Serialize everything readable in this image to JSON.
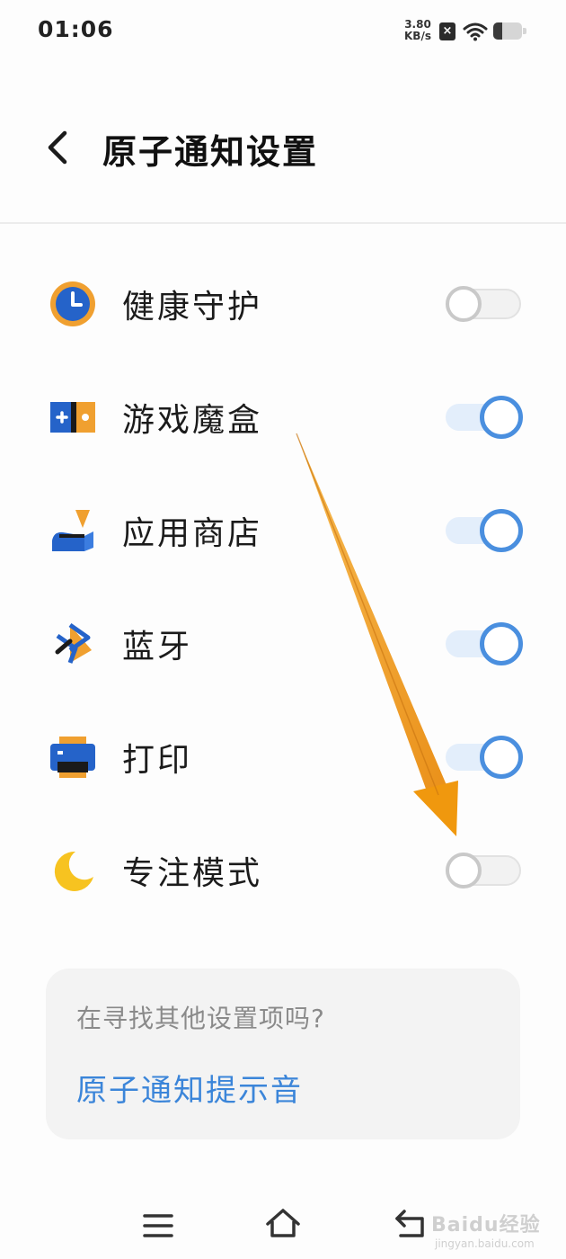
{
  "status_bar": {
    "time": "01:06",
    "net_speed_value": "3.80",
    "net_speed_unit": "KB/s",
    "sim_status_icon": "no-sim-icon",
    "wifi_icon": "wifi-icon",
    "battery_level": 0.3
  },
  "header": {
    "title": "原子通知设置",
    "back_icon": "back-arrow-icon"
  },
  "settings": [
    {
      "label": "健康守护",
      "icon": "health-guard-clock-icon",
      "enabled": false
    },
    {
      "label": "游戏魔盒",
      "icon": "game-box-icon",
      "enabled": true
    },
    {
      "label": "应用商店",
      "icon": "app-store-icon",
      "enabled": true
    },
    {
      "label": "蓝牙",
      "icon": "bluetooth-icon",
      "enabled": true
    },
    {
      "label": "打印",
      "icon": "printer-icon",
      "enabled": true
    },
    {
      "label": "专注模式",
      "icon": "moon-focus-icon",
      "enabled": false
    }
  ],
  "info_card": {
    "question": "在寻找其他设置项吗?",
    "link": "原子通知提示音"
  },
  "nav_bar": {
    "menu_icon": "menu-icon",
    "home_icon": "home-icon",
    "back_icon": "back-icon"
  },
  "watermark": {
    "main": "Baidu经验",
    "sub": "jingyan.baidu.com"
  },
  "colors": {
    "accent_blue": "#4a8fdf",
    "link_blue": "#3b85d9",
    "arrow_orange": "#f3a020",
    "icon_orange": "#f0a030",
    "icon_blue": "#2563c9"
  }
}
